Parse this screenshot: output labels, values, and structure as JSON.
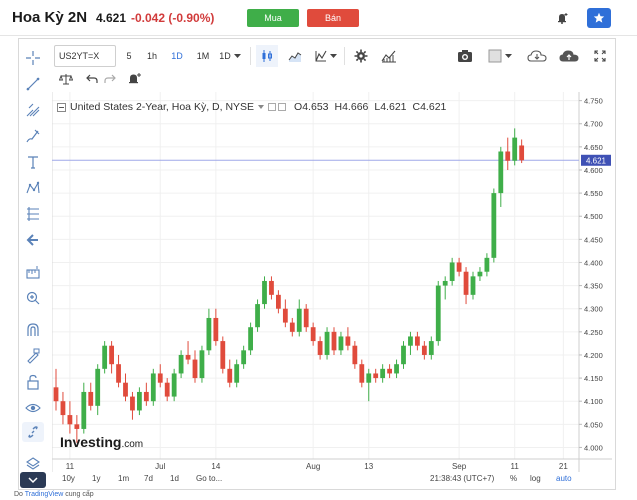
{
  "header": {
    "title": "Hoa Kỳ 2N",
    "price": "4.621",
    "change": "-0.042 (-0.90%)",
    "buy_label": "Mua",
    "sell_label": "Bán",
    "colors": {
      "up": "#3fae49",
      "down": "#e04b3c",
      "accent": "#2f6fd8"
    }
  },
  "toolbar": {
    "symbol": "US2YT=X",
    "intervals": [
      "5",
      "1h",
      "1D",
      "1M",
      "1D"
    ],
    "active_interval": "1D",
    "icons": [
      "candles-icon",
      "area-chart-icon",
      "indicators-icon",
      "settings-icon",
      "studies-icon",
      "camera-icon",
      "color-swatch-icon",
      "cloud-download-icon",
      "cloud-upload-icon",
      "fullscreen-icon"
    ]
  },
  "toolbar2": {
    "icons": [
      "scales-icon",
      "undo-icon",
      "redo-icon",
      "alert-icon"
    ]
  },
  "legend": {
    "name": "United States 2-Year, Hoa Kỳ, D, NYSE",
    "o_label": "O",
    "o": "4.653",
    "h_label": "H",
    "h": "4.666",
    "l_label": "L",
    "l": "4.621",
    "c_label": "C",
    "c": "4.621"
  },
  "left_tools": [
    "crosshair-icon",
    "trend-line-icon",
    "pitchfork-icon",
    "brush-icon",
    "text-icon",
    "pattern-icon",
    "fib-icon",
    "arrow-left-icon",
    "measure-icon",
    "zoom-icon",
    "magnet-icon",
    "lock-pencil-icon",
    "lock-icon",
    "eye-icon",
    "link-icon",
    "layers-icon",
    "collapse-icon"
  ],
  "chart_data": {
    "type": "candlestick",
    "title": "United States 2-Year, Hoa Kỳ, D, NYSE",
    "xlabel": "",
    "ylabel": "",
    "ylim": [
      3.975,
      4.76
    ],
    "y_ticks": [
      "4.750",
      "4.700",
      "4.650",
      "4.600",
      "4.550",
      "4.500",
      "4.450",
      "4.400",
      "4.350",
      "4.300",
      "4.250",
      "4.200",
      "4.150",
      "4.100",
      "4.050",
      "4.000"
    ],
    "x_ticks": [
      {
        "label": "11",
        "index": 2
      },
      {
        "label": "Jul",
        "index": 15
      },
      {
        "label": "14",
        "index": 23
      },
      {
        "label": "Aug",
        "index": 37
      },
      {
        "label": "13",
        "index": 45
      },
      {
        "label": "Sep",
        "index": 58
      },
      {
        "label": "11",
        "index": 66
      },
      {
        "label": "21",
        "index": 73
      }
    ],
    "current_price": 4.621,
    "current_price_label": "4.621",
    "candles": [
      [
        4.13,
        4.17,
        4.08,
        4.1
      ],
      [
        4.1,
        4.12,
        4.05,
        4.07
      ],
      [
        4.07,
        4.1,
        4.03,
        4.05
      ],
      [
        4.05,
        4.07,
        4.01,
        4.04
      ],
      [
        4.04,
        4.14,
        4.03,
        4.12
      ],
      [
        4.12,
        4.14,
        4.08,
        4.09
      ],
      [
        4.09,
        4.18,
        4.07,
        4.17
      ],
      [
        4.17,
        4.23,
        4.16,
        4.22
      ],
      [
        4.22,
        4.23,
        4.16,
        4.18
      ],
      [
        4.18,
        4.2,
        4.13,
        4.14
      ],
      [
        4.14,
        4.16,
        4.1,
        4.11
      ],
      [
        4.11,
        4.12,
        4.06,
        4.08
      ],
      [
        4.08,
        4.13,
        4.07,
        4.12
      ],
      [
        4.12,
        4.14,
        4.09,
        4.1
      ],
      [
        4.1,
        4.17,
        4.09,
        4.16
      ],
      [
        4.16,
        4.18,
        4.13,
        4.14
      ],
      [
        4.14,
        4.15,
        4.1,
        4.11
      ],
      [
        4.11,
        4.17,
        4.1,
        4.16
      ],
      [
        4.16,
        4.21,
        4.15,
        4.2
      ],
      [
        4.2,
        4.23,
        4.18,
        4.19
      ],
      [
        4.19,
        4.21,
        4.14,
        4.15
      ],
      [
        4.15,
        4.22,
        4.14,
        4.21
      ],
      [
        4.21,
        4.3,
        4.2,
        4.28
      ],
      [
        4.28,
        4.3,
        4.22,
        4.23
      ],
      [
        4.23,
        4.24,
        4.16,
        4.17
      ],
      [
        4.17,
        4.19,
        4.13,
        4.14
      ],
      [
        4.14,
        4.19,
        4.13,
        4.18
      ],
      [
        4.18,
        4.22,
        4.17,
        4.21
      ],
      [
        4.21,
        4.27,
        4.2,
        4.26
      ],
      [
        4.26,
        4.32,
        4.25,
        4.31
      ],
      [
        4.31,
        4.37,
        4.3,
        4.36
      ],
      [
        4.36,
        4.37,
        4.32,
        4.33
      ],
      [
        4.33,
        4.34,
        4.29,
        4.3
      ],
      [
        4.3,
        4.32,
        4.26,
        4.27
      ],
      [
        4.27,
        4.28,
        4.24,
        4.25
      ],
      [
        4.25,
        4.32,
        4.24,
        4.3
      ],
      [
        4.3,
        4.31,
        4.25,
        4.26
      ],
      [
        4.26,
        4.27,
        4.22,
        4.23
      ],
      [
        4.23,
        4.24,
        4.19,
        4.2
      ],
      [
        4.2,
        4.26,
        4.19,
        4.25
      ],
      [
        4.25,
        4.26,
        4.2,
        4.21
      ],
      [
        4.21,
        4.25,
        4.2,
        4.24
      ],
      [
        4.24,
        4.26,
        4.21,
        4.22
      ],
      [
        4.22,
        4.23,
        4.17,
        4.18
      ],
      [
        4.18,
        4.19,
        4.13,
        4.14
      ],
      [
        4.14,
        4.17,
        4.1,
        4.16
      ],
      [
        4.16,
        4.17,
        4.14,
        4.15
      ],
      [
        4.15,
        4.18,
        4.14,
        4.17
      ],
      [
        4.17,
        4.18,
        4.15,
        4.16
      ],
      [
        4.16,
        4.19,
        4.15,
        4.18
      ],
      [
        4.18,
        4.23,
        4.17,
        4.22
      ],
      [
        4.22,
        4.25,
        4.2,
        4.24
      ],
      [
        4.24,
        4.25,
        4.21,
        4.22
      ],
      [
        4.22,
        4.23,
        4.19,
        4.2
      ],
      [
        4.2,
        4.24,
        4.19,
        4.23
      ],
      [
        4.23,
        4.36,
        4.22,
        4.35
      ],
      [
        4.35,
        4.37,
        4.32,
        4.36
      ],
      [
        4.36,
        4.41,
        4.35,
        4.4
      ],
      [
        4.4,
        4.41,
        4.37,
        4.38
      ],
      [
        4.38,
        4.39,
        4.31,
        4.33
      ],
      [
        4.33,
        4.38,
        4.32,
        4.37
      ],
      [
        4.37,
        4.39,
        4.36,
        4.38
      ],
      [
        4.38,
        4.42,
        4.37,
        4.41
      ],
      [
        4.41,
        4.56,
        4.4,
        4.55
      ],
      [
        4.55,
        4.65,
        4.52,
        4.64
      ],
      [
        4.64,
        4.67,
        4.6,
        4.62
      ],
      [
        4.62,
        4.69,
        4.61,
        4.67
      ],
      [
        4.653,
        4.666,
        4.615,
        4.621
      ]
    ]
  },
  "bottombar": {
    "ranges": [
      "10y",
      "1y",
      "1m",
      "7d",
      "1d",
      "Go to..."
    ],
    "time": "21:38:43 (UTC+7)",
    "percent": "%",
    "log": "log",
    "auto": "auto"
  },
  "watermark": "Investing",
  "watermark_suffix": ".com",
  "footer": {
    "prefix": "Do ",
    "link": "TradingView",
    "suffix": " cung cấp"
  }
}
